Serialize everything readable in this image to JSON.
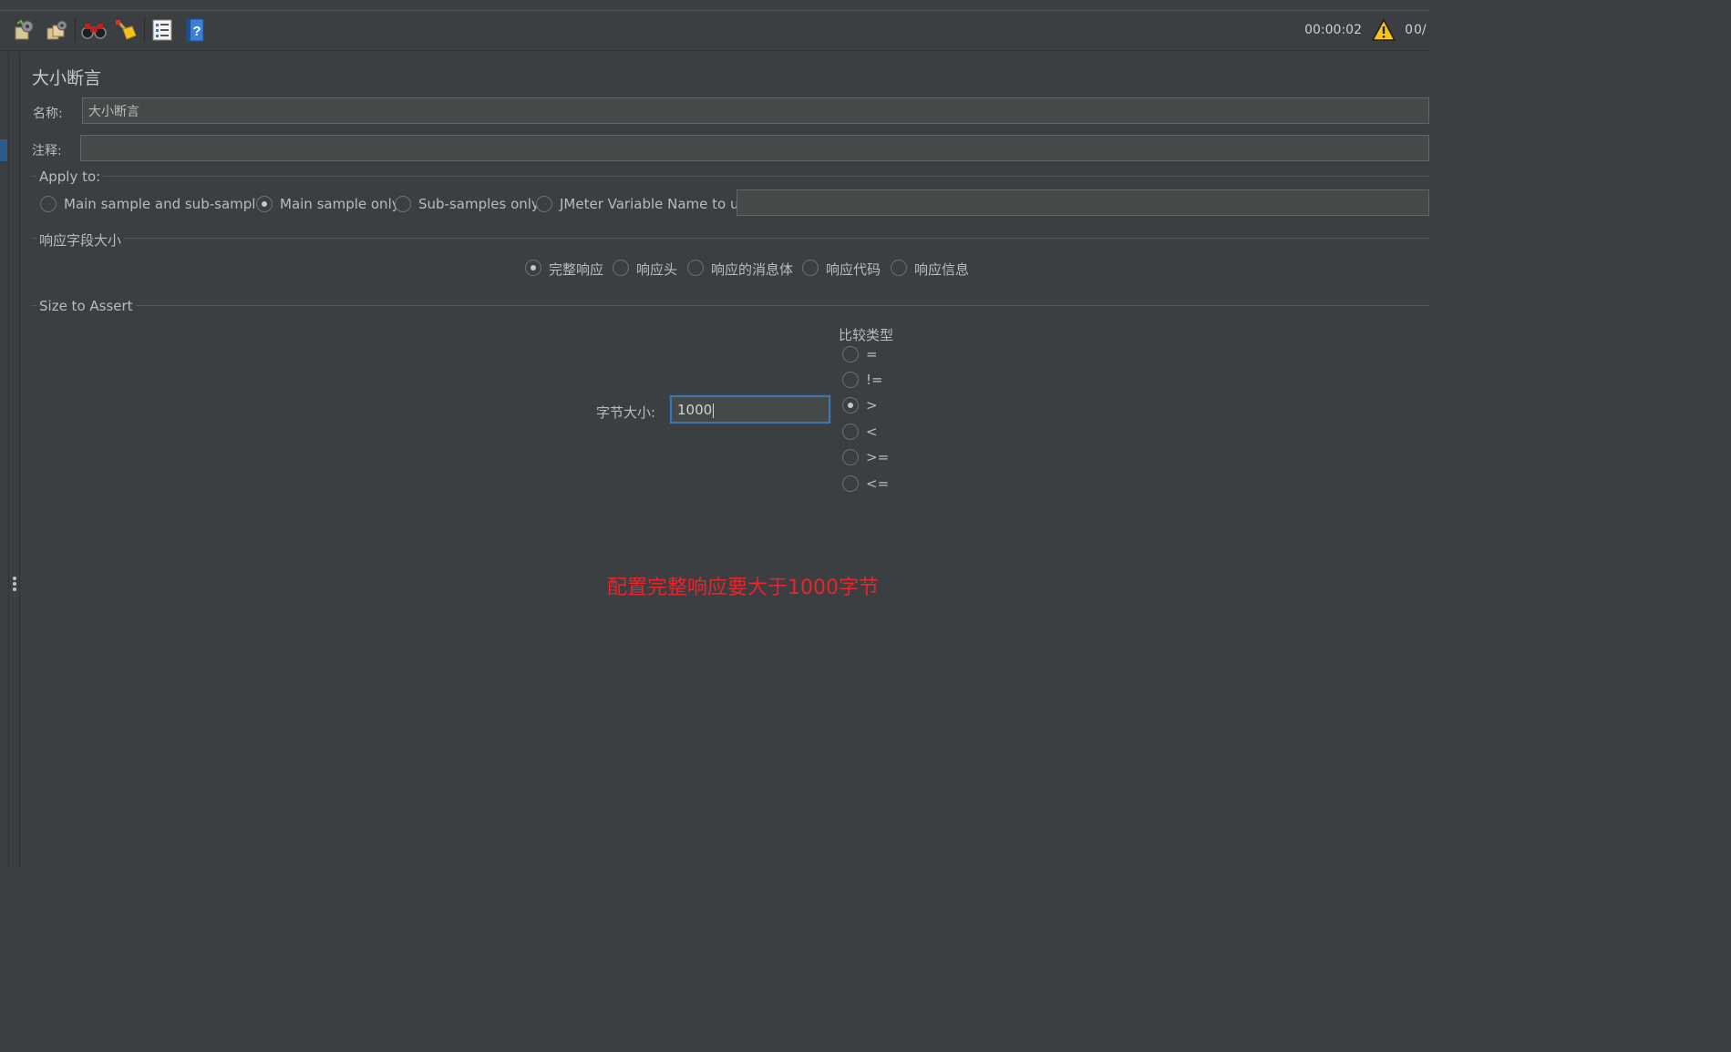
{
  "toolbar": {
    "icons": [
      "clear-gear-icon",
      "clear-all-gear-icon",
      "binoculars-icon",
      "broom-icon",
      "list-icon",
      "help-book-icon"
    ],
    "timer": "00:00:02",
    "warning_count": "0",
    "thread_count": "0/"
  },
  "panel": {
    "title": "大小断言",
    "name_label": "名称:",
    "name_value": "大小断言",
    "comment_label": "注释:",
    "comment_value": ""
  },
  "apply_to": {
    "title": "Apply to:",
    "options": [
      {
        "label": "Main sample and sub-samples",
        "selected": false
      },
      {
        "label": "Main sample only",
        "selected": true
      },
      {
        "label": "Sub-samples only",
        "selected": false
      },
      {
        "label": "JMeter Variable Name to use",
        "selected": false
      }
    ],
    "variable_value": ""
  },
  "response_field": {
    "title": "响应字段大小",
    "options": [
      {
        "label": "完整响应",
        "selected": true
      },
      {
        "label": "响应头",
        "selected": false
      },
      {
        "label": "响应的消息体",
        "selected": false
      },
      {
        "label": "响应代码",
        "selected": false
      },
      {
        "label": "响应信息",
        "selected": false
      }
    ]
  },
  "size_to_assert": {
    "title": "Size to Assert",
    "size_label": "字节大小:",
    "size_value": "1000",
    "compare_title": "比较类型",
    "compare_options": [
      {
        "label": "=",
        "selected": false
      },
      {
        "label": "!=",
        "selected": false
      },
      {
        "label": ">",
        "selected": true
      },
      {
        "label": "<",
        "selected": false
      },
      {
        "label": ">=",
        "selected": false
      },
      {
        "label": "<=",
        "selected": false
      }
    ]
  },
  "annotation": {
    "text": "配置完整响应要大于1000字节",
    "color": "#e8242c"
  },
  "colors": {
    "background": "#3c3f41",
    "field_bg": "#45494a",
    "focus_border": "#3d75b0"
  }
}
